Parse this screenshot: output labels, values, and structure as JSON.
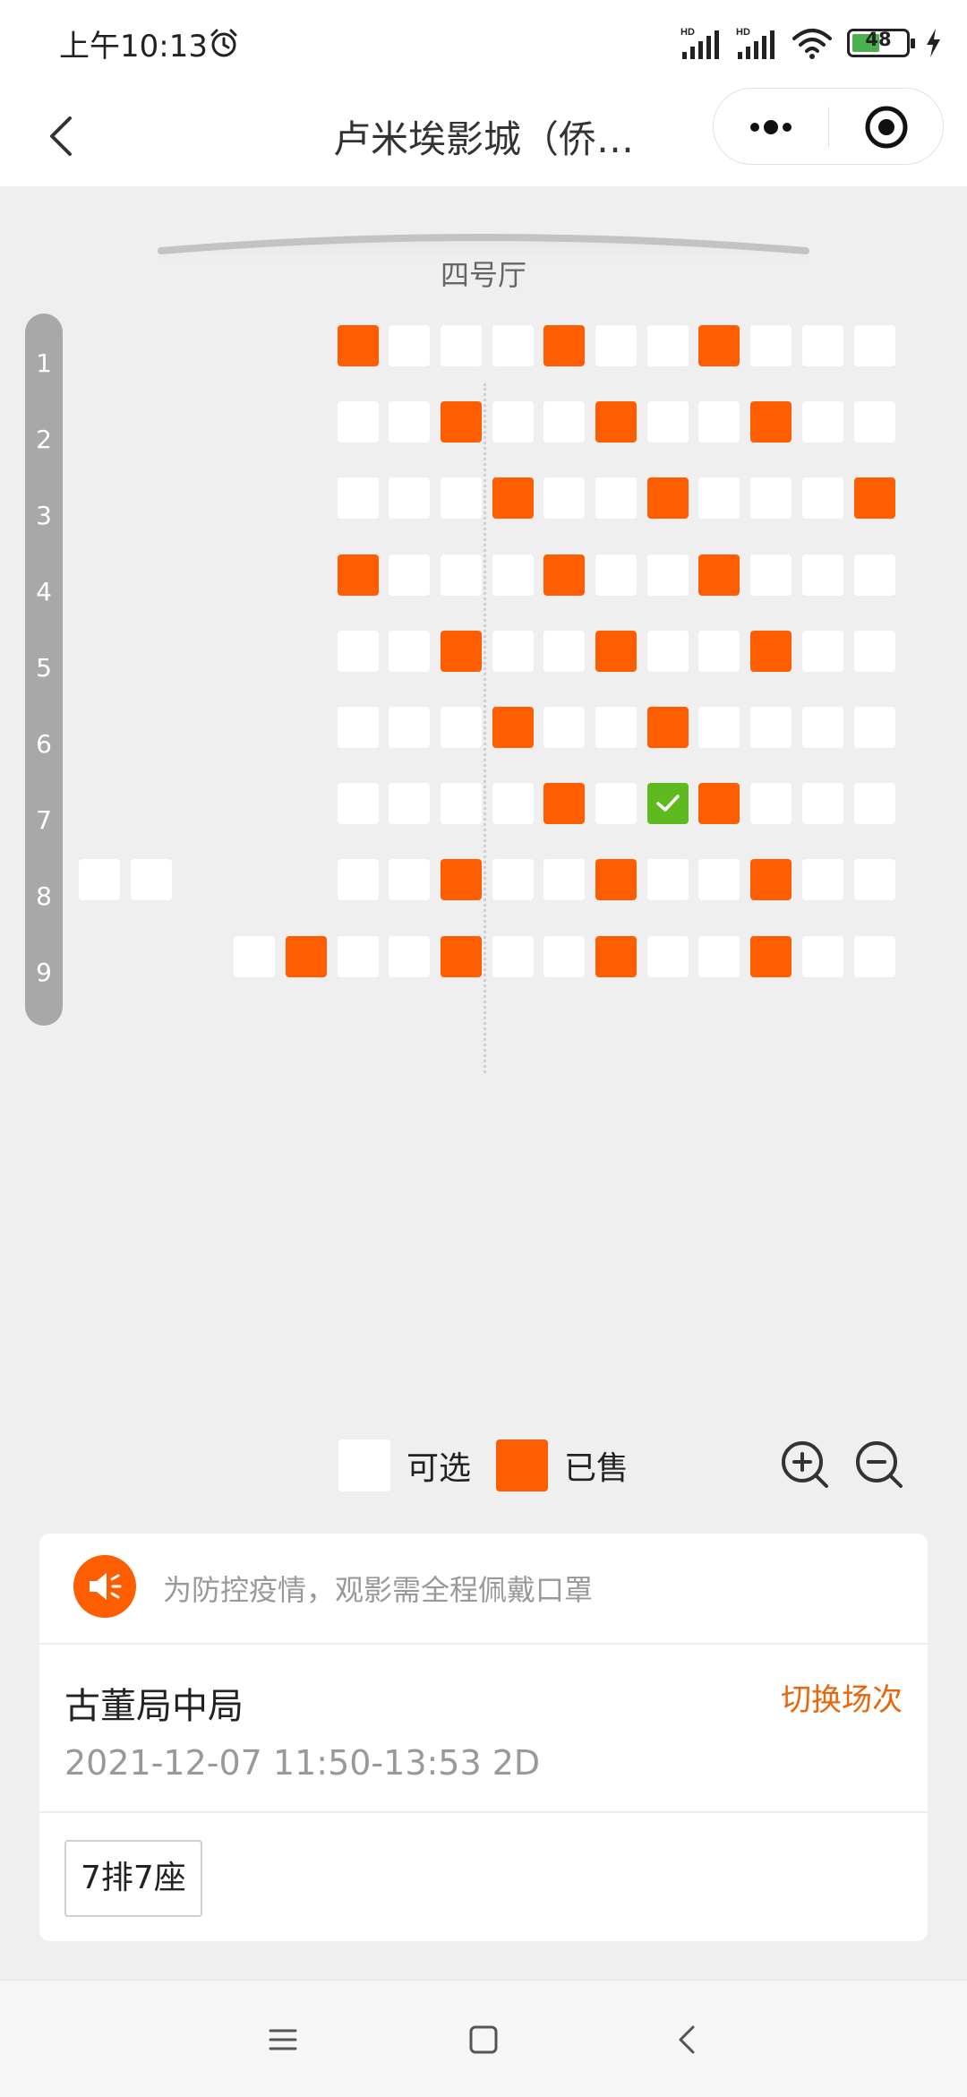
{
  "status_bar": {
    "time": "上午10:13",
    "battery_level": "48",
    "icons": [
      "alarm-icon",
      "hd-signal-icon",
      "hd-signal-icon",
      "wifi-icon",
      "battery-icon",
      "charging-icon"
    ]
  },
  "nav": {
    "title": "卢米埃影城（侨…",
    "icons": [
      "back-icon",
      "more-icon",
      "close-icon"
    ]
  },
  "hall": {
    "name": "四号厅"
  },
  "rows": [
    {
      "label": "1"
    },
    {
      "label": "2"
    },
    {
      "label": "3"
    },
    {
      "label": "4"
    },
    {
      "label": "5"
    },
    {
      "label": "6"
    },
    {
      "label": "7"
    },
    {
      "label": "8"
    },
    {
      "label": "9"
    }
  ],
  "seat_map": {
    "columns": 16,
    "legend_codes": {
      "a": "可选",
      "s": "已售",
      "x": "selected",
      "-": "no seat"
    },
    "rows": [
      "-----saaasaasaaa",
      "-----aasaasaasaa",
      "-----aaasaasaaas",
      "-----saaasaasaaa",
      "-----aasaasaasaa",
      "-----aaasaasaaaa",
      "-----aaaasaxsaaa",
      "aa---aasaasaasaa",
      "---asaasaasaasaa"
    ]
  },
  "legend": {
    "available": "可选",
    "sold": "已售"
  },
  "zoom": {
    "icons": [
      "zoom-in-icon",
      "zoom-out-icon"
    ]
  },
  "colors": {
    "sold": "#ff5e00",
    "selected": "#5eba1e",
    "accent": "#e8670c",
    "available": "#ffffff"
  },
  "notice": {
    "text": "为防控疫情，观影需全程佩戴口罩",
    "icon": "speaker-icon"
  },
  "movie": {
    "name": "古董局中局",
    "switch_label": "切换场次",
    "showtime": "2021-12-07 11:50-13:53 2D"
  },
  "selected_seats": [
    "7排7座"
  ],
  "system_nav": {
    "icons": [
      "menu-icon",
      "home-icon",
      "back-icon"
    ]
  }
}
